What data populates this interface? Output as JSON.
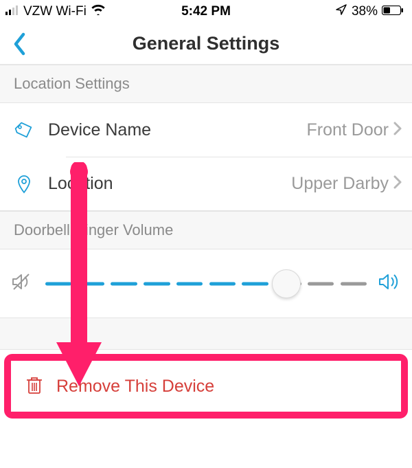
{
  "status": {
    "carrier": "VZW Wi-Fi",
    "time": "5:42 PM",
    "battery_pct": "38%"
  },
  "nav": {
    "title": "General Settings"
  },
  "sections": {
    "location": {
      "header": "Location Settings",
      "device_name_label": "Device Name",
      "device_name_value": "Front Door",
      "location_label": "Location",
      "location_value": "Upper Darby"
    },
    "volume": {
      "header": "Doorbell Ringer Volume",
      "value_pct": 75
    },
    "remove": {
      "label": "Remove This Device"
    }
  },
  "colors": {
    "accent": "#1fa0d8",
    "danger": "#d63f3a",
    "highlight": "#ff1f6a",
    "muted": "#9a9a9a"
  }
}
